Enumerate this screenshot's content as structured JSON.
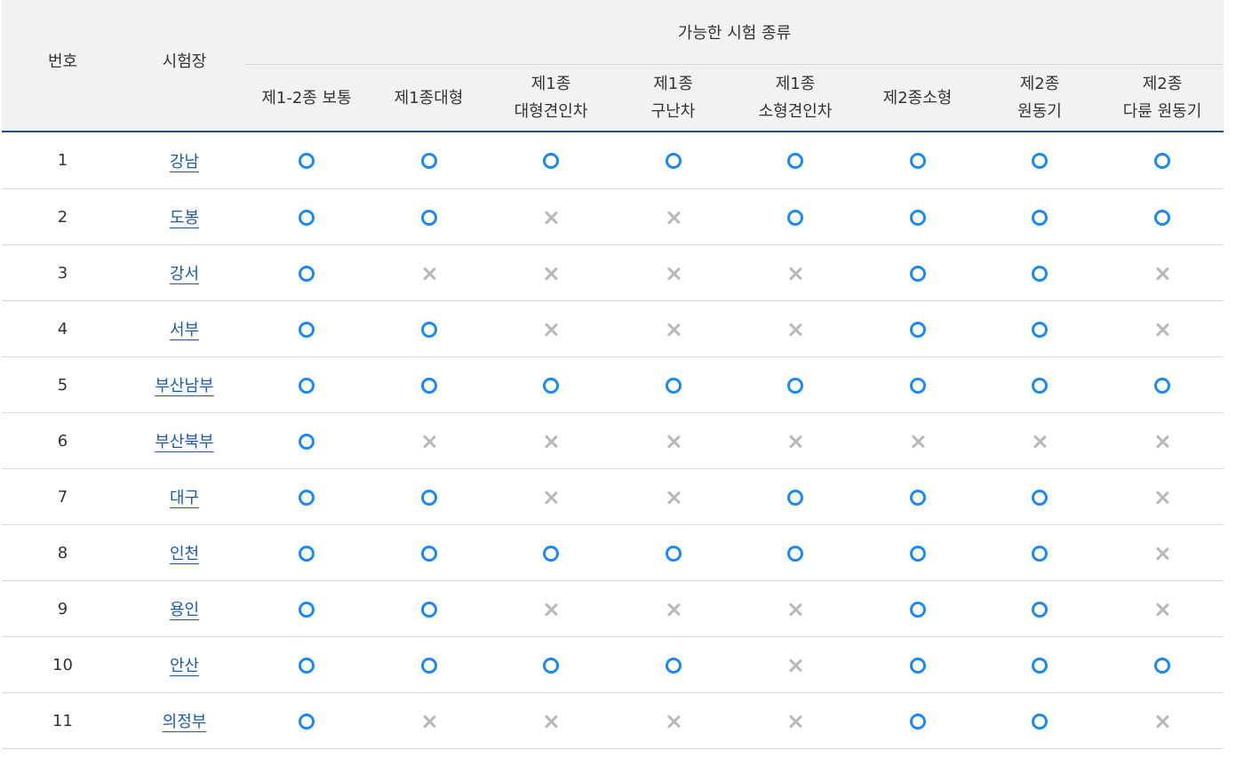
{
  "headers": {
    "number": "번호",
    "center": "시험장",
    "group": "가능한 시험 종류",
    "exam_types": [
      [
        "제1-2종 보통"
      ],
      [
        "제1종대형"
      ],
      [
        "제1종",
        "대형견인차"
      ],
      [
        "제1종",
        "구난차"
      ],
      [
        "제1종",
        "소형견인차"
      ],
      [
        "제2종소형"
      ],
      [
        "제2종",
        "원동기"
      ],
      [
        "제2종",
        "다륜 원동기"
      ]
    ]
  },
  "legend": {
    "available_icon": "circle-o-icon",
    "unavailable_icon": "x-mark-icon",
    "available_color": "#1e88f0",
    "unavailable_color": "#b8b8b8"
  },
  "rows": [
    {
      "no": "1",
      "center": "강남",
      "avail": [
        "O",
        "O",
        "O",
        "O",
        "O",
        "O",
        "O",
        "O"
      ]
    },
    {
      "no": "2",
      "center": "도봉",
      "avail": [
        "O",
        "O",
        "X",
        "X",
        "O",
        "O",
        "O",
        "O"
      ]
    },
    {
      "no": "3",
      "center": "강서",
      "avail": [
        "O",
        "X",
        "X",
        "X",
        "X",
        "O",
        "O",
        "X"
      ]
    },
    {
      "no": "4",
      "center": "서부",
      "avail": [
        "O",
        "O",
        "X",
        "X",
        "X",
        "O",
        "O",
        "X"
      ]
    },
    {
      "no": "5",
      "center": "부산남부",
      "avail": [
        "O",
        "O",
        "O",
        "O",
        "O",
        "O",
        "O",
        "O"
      ]
    },
    {
      "no": "6",
      "center": "부산북부",
      "avail": [
        "O",
        "X",
        "X",
        "X",
        "X",
        "X",
        "X",
        "X"
      ]
    },
    {
      "no": "7",
      "center": "대구",
      "avail": [
        "O",
        "O",
        "X",
        "X",
        "O",
        "O",
        "O",
        "X"
      ]
    },
    {
      "no": "8",
      "center": "인천",
      "avail": [
        "O",
        "O",
        "O",
        "O",
        "O",
        "O",
        "O",
        "X"
      ]
    },
    {
      "no": "9",
      "center": "용인",
      "avail": [
        "O",
        "O",
        "X",
        "X",
        "X",
        "O",
        "O",
        "X"
      ]
    },
    {
      "no": "10",
      "center": "안산",
      "avail": [
        "O",
        "O",
        "O",
        "O",
        "X",
        "O",
        "O",
        "O"
      ]
    },
    {
      "no": "11",
      "center": "의정부",
      "avail": [
        "O",
        "X",
        "X",
        "X",
        "X",
        "O",
        "O",
        "X"
      ]
    }
  ]
}
